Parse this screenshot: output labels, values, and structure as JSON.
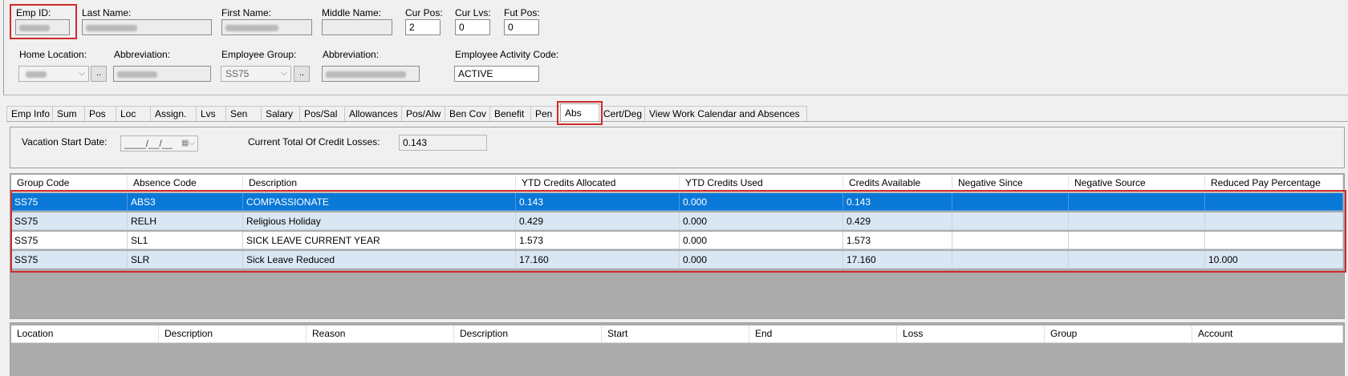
{
  "header": {
    "emp_id_label": "Emp ID:",
    "last_name_label": "Last Name:",
    "first_name_label": "First Name:",
    "middle_name_label": "Middle Name:",
    "middle_name_value": "",
    "cur_pos_label": "Cur Pos:",
    "cur_pos_value": "2",
    "cur_lvs_label": "Cur Lvs:",
    "cur_lvs_value": "0",
    "fut_pos_label": "Fut Pos:",
    "fut_pos_value": "0",
    "home_location_label": "Home Location:",
    "abbreviation_label": "Abbreviation:",
    "employee_group_label": "Employee Group:",
    "employee_group_value": "SS75",
    "abbreviation2_label": "Abbreviation:",
    "activity_code_label": "Employee Activity Code:",
    "activity_code_value": "ACTIVE",
    "browse_label": ".."
  },
  "tabs": [
    {
      "label": "Emp Info"
    },
    {
      "label": "Sum"
    },
    {
      "label": "Pos"
    },
    {
      "label": "Loc"
    },
    {
      "label": "Assign."
    },
    {
      "label": "Lvs"
    },
    {
      "label": "Sen"
    },
    {
      "label": "Salary"
    },
    {
      "label": "Pos/Sal"
    },
    {
      "label": "Allowances"
    },
    {
      "label": "Pos/Alw"
    },
    {
      "label": "Ben Cov"
    },
    {
      "label": "Benefit"
    },
    {
      "label": "Pen"
    },
    {
      "label": "Abs"
    },
    {
      "label": "Cert/Deg"
    },
    {
      "label": "View Work Calendar and Absences"
    }
  ],
  "active_tab": "Abs",
  "abs_panel": {
    "vacation_start_label": "Vacation Start Date:",
    "vacation_start_value": "____/__/__",
    "credit_losses_label": "Current Total Of Credit Losses:",
    "credit_losses_value": "0.143"
  },
  "credits_table": {
    "columns": [
      "Group Code",
      "Absence Code",
      "Description",
      "YTD Credits Allocated",
      "YTD Credits Used",
      "Credits Available",
      "Negative Since",
      "Negative Source",
      "Reduced Pay Percentage"
    ],
    "rows": [
      [
        "SS75",
        "ABS3",
        "COMPASSIONATE",
        "0.143",
        "0.000",
        "0.143",
        "",
        "",
        ""
      ],
      [
        "SS75",
        "RELH",
        "Religious Holiday",
        "0.429",
        "0.000",
        "0.429",
        "",
        "",
        ""
      ],
      [
        "SS75",
        "SL1",
        "SICK LEAVE CURRENT YEAR",
        "1.573",
        "0.000",
        "1.573",
        "",
        "",
        ""
      ],
      [
        "SS75",
        "SLR",
        "Sick Leave Reduced",
        "17.160",
        "0.000",
        "17.160",
        "",
        "",
        "10.000"
      ]
    ]
  },
  "loss_table": {
    "columns": [
      "Location",
      "Description",
      "Reason",
      "Description",
      "Start",
      "End",
      "Loss",
      "Group",
      "Account"
    ]
  },
  "colors": {
    "selection": "#0a78d7",
    "alt_row": "#d9e6f4",
    "highlight_box": "#d02a2a",
    "empty_grid": "#ababab"
  }
}
